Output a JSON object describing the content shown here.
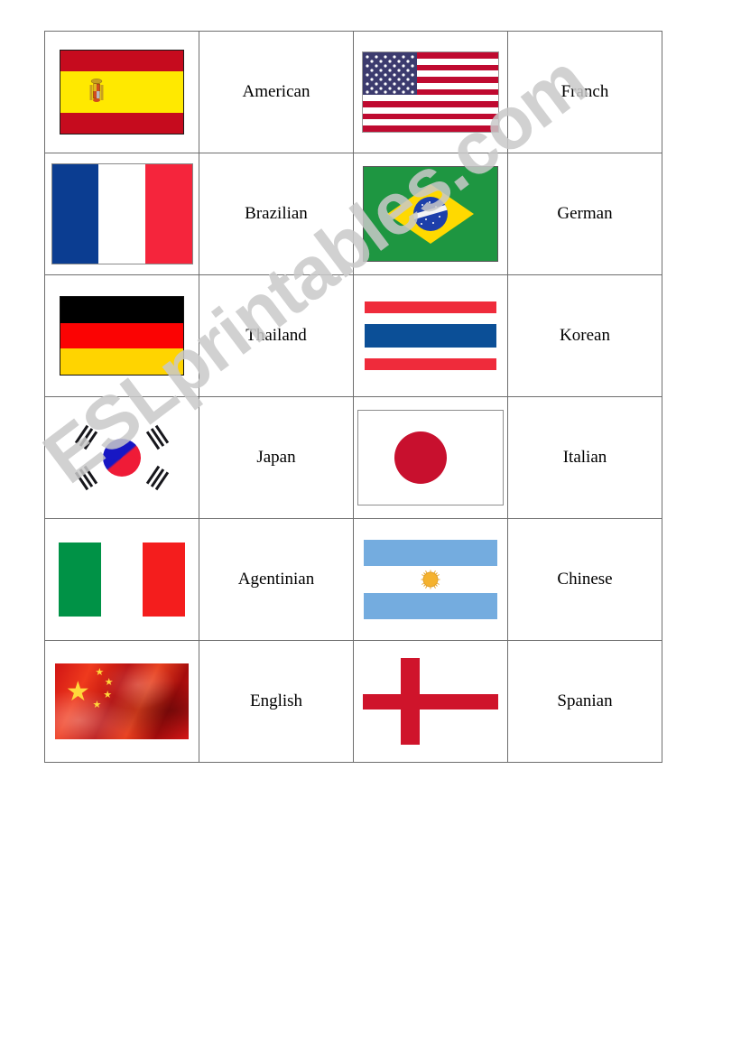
{
  "document": {
    "type": "esl-matching-worksheet",
    "watermark": "ESLprintables.com"
  },
  "table": {
    "rows": [
      {
        "left_flag": {
          "name": "spain-flag",
          "country": "Spain"
        },
        "left_word": "American",
        "right_flag": {
          "name": "usa-flag",
          "country": "United States"
        },
        "right_word": "Franch"
      },
      {
        "left_flag": {
          "name": "france-flag",
          "country": "France"
        },
        "left_word": "Brazilian",
        "right_flag": {
          "name": "brazil-flag",
          "country": "Brazil"
        },
        "right_word": "German"
      },
      {
        "left_flag": {
          "name": "germany-flag",
          "country": "Germany"
        },
        "left_word": "Thailand",
        "right_flag": {
          "name": "thailand-flag",
          "country": "Thailand"
        },
        "right_word": "Korean"
      },
      {
        "left_flag": {
          "name": "south-korea-flag",
          "country": "South Korea"
        },
        "left_word": "Japan",
        "right_flag": {
          "name": "japan-flag",
          "country": "Japan"
        },
        "right_word": "Italian"
      },
      {
        "left_flag": {
          "name": "italy-flag",
          "country": "Italy"
        },
        "left_word": "Agentinian",
        "right_flag": {
          "name": "argentina-flag",
          "country": "Argentina"
        },
        "right_word": "Chinese"
      },
      {
        "left_flag": {
          "name": "china-flag",
          "country": "China"
        },
        "left_word": "English",
        "right_flag": {
          "name": "england-flag",
          "country": "England"
        },
        "right_word": "Spanian"
      }
    ]
  },
  "colors": {
    "border": "#6e6e6e",
    "text": "#000000",
    "watermark": "#c9c9c9",
    "spain_red": "#c60b1e",
    "spain_yellow": "#ffe900",
    "usa_blue": "#3c3b6e",
    "usa_red": "#bf0a30",
    "france_blue": "#0b3d91",
    "france_red": "#f5253c",
    "brazil_green": "#1e9641",
    "brazil_yellow": "#ffd900",
    "brazil_blue": "#1d3faa",
    "germany_red": "#fb0303",
    "germany_gold": "#ffd400",
    "thailand_red": "#ef2b3b",
    "thailand_blue": "#0b4f97",
    "korea_blue": "#1717c4",
    "korea_red": "#ef1b37",
    "japan_red": "#c8102e",
    "italy_green": "#009246",
    "italy_red": "#f41d1d",
    "argentina_blue": "#74acdf",
    "argentina_sun": "#f5b22d",
    "china_red": "#d01414",
    "china_star": "#ffd93b",
    "england_red": "#cf142b"
  }
}
